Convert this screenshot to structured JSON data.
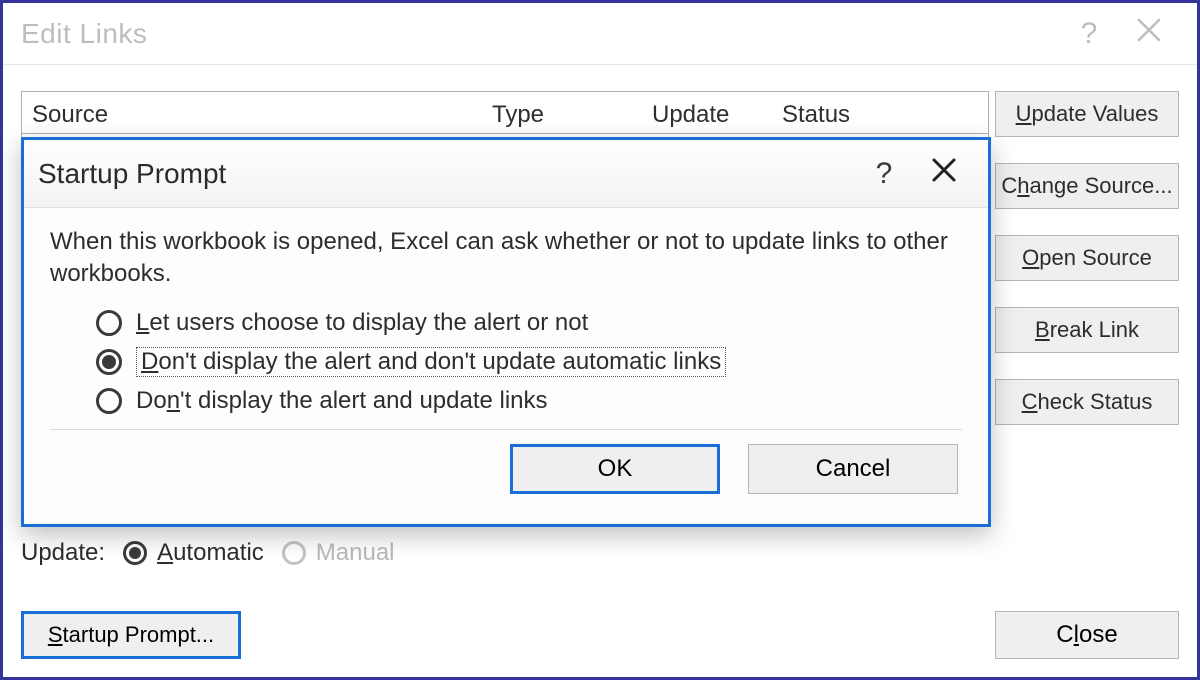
{
  "editLinks": {
    "title": "Edit Links",
    "columns": {
      "source": "Source",
      "type": "Type",
      "update": "Update",
      "status": "Status"
    },
    "buttons": {
      "updateValues": {
        "u": "U",
        "rest": "pdate Values"
      },
      "changeSource": {
        "pre": "C",
        "u": "h",
        "rest": "ange Source..."
      },
      "openSource": {
        "u": "O",
        "rest": "pen Source"
      },
      "breakLink": {
        "u": "B",
        "rest": "reak Link"
      },
      "checkStatus": {
        "u": "C",
        "rest": "heck Status"
      },
      "close": {
        "pre": "C",
        "u": "l",
        "rest": "ose"
      },
      "startupPrompt": {
        "u": "S",
        "rest": "tartup Prompt..."
      }
    },
    "updateRow": {
      "label": "Update:",
      "automatic": {
        "u": "A",
        "rest": "utomatic"
      },
      "manual": "Manual",
      "selected": "automatic",
      "manualEnabled": false
    }
  },
  "startupPrompt": {
    "title": "Startup Prompt",
    "description": "When this workbook is opened, Excel can ask whether or not to update links to other workbooks.",
    "options": [
      {
        "u": "L",
        "rest": "et users choose to display the alert or not",
        "selected": false
      },
      {
        "u": "D",
        "rest": "on't display the alert and don't update automatic links",
        "selected": true
      },
      {
        "pre": "Do",
        "u": "n",
        "rest": "'t display the alert and update links",
        "selected": false
      }
    ],
    "ok": "OK",
    "cancel": "Cancel"
  }
}
